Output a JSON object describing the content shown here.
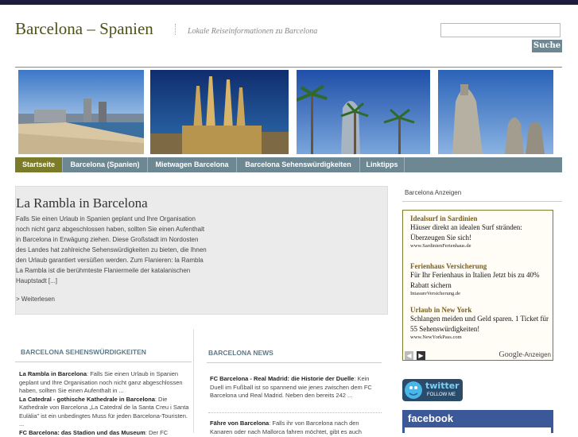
{
  "header": {
    "site_title": "Barcelona – Spanien",
    "tagline": "Lokale Reiseinformationen zu Barcelona",
    "search_placeholder": "",
    "search_button": "Suche"
  },
  "nav": {
    "items": [
      {
        "label": "Startseite"
      },
      {
        "label": "Barcelona (Spanien)"
      },
      {
        "label": "Mietwagen Barcelona"
      },
      {
        "label": "Barcelona Sehenswürdigkeiten"
      },
      {
        "label": "Linktipps"
      }
    ]
  },
  "feature": {
    "title": "La Rambla in Barcelona",
    "text": "Falls Sie einen Urlaub in Spanien geplant und Ihre Organisation noch nicht ganz abgeschlossen haben, sollten Sie einen Aufenthalt in Barcelona in Erwägung ziehen. Diese Großstadt im Nordosten des Landes hat zahlreiche Sehenswürdigkeiten zu bieten, die Ihnen den Urlaub garantiert versüßen werden. Zum Flanieren: la Rambla La Rambla ist die berühmteste Flaniermeile der katalanischen Hauptstadt [...]",
    "more": "> Weiterlesen"
  },
  "sights": {
    "heading": "BARCELONA SEHENSWÜRDIGKEITEN",
    "posts": [
      {
        "title": "La Rambla in Barcelona",
        "text": ": Falls Sie einen Urlaub in Spanien geplant und Ihre Organisation noch nicht ganz abgeschlossen haben, sollten Sie einen Aufenthalt in ..."
      },
      {
        "title": "La Catedral - gothische Kathedrale in Barcelona",
        "text": ": Die Kathedrale von Barcelona „La Catedral de la Santa Creu i Santa Eulàlia\" ist ein unbedingtes Muss für jeden Barcelona-Touristen. ..."
      },
      {
        "title": "FC Barcelona: das Stadion und das Museum",
        "text": ": Der FC"
      }
    ]
  },
  "news": {
    "heading": "BARCELONA NEWS",
    "posts": [
      {
        "title": "FC Barcelona - Real Madrid: die Historie der Duelle",
        "text": ": Kein Duell im Fußball ist so spannend wie jenes zwischen dem FC Barcelona und Real Madrid. Neben den bereits 242 ..."
      },
      {
        "title": "Fähre von Barcelona",
        "text": ": Falls ihr von Barcelona nach den Kanaren oder nach Mallorca fahren möchtet, gibt es auch"
      }
    ]
  },
  "sidebar": {
    "ads_heading": "Barcelona Anzeigen",
    "ads": [
      {
        "title": "Idealsurf in Sardinien",
        "text": "Häuser direkt an idealen Surf stränden: Überzeugen Sie sich!",
        "url": "www.SardinienFerienhaus.de"
      },
      {
        "title": "Ferienhaus Versicherung",
        "text": "Für Ihr Ferienhaus in Italien Jetzt bis zu 40% Rabatt sichern",
        "url": "IntasureVersicherung.de"
      },
      {
        "title": "Urlaub in New York",
        "text": "Schlangen meiden und Geld sparen. 1 Ticket für 55 Sehenswürdigkeiten!",
        "url": "www.NewYorkPass.com"
      }
    ],
    "ads_label_brand": "Google",
    "ads_label_suffix": "-Anzeigen",
    "twitter_label": "twitter",
    "twitter_sub": "FOLLOW ME",
    "facebook_label": "facebook"
  }
}
